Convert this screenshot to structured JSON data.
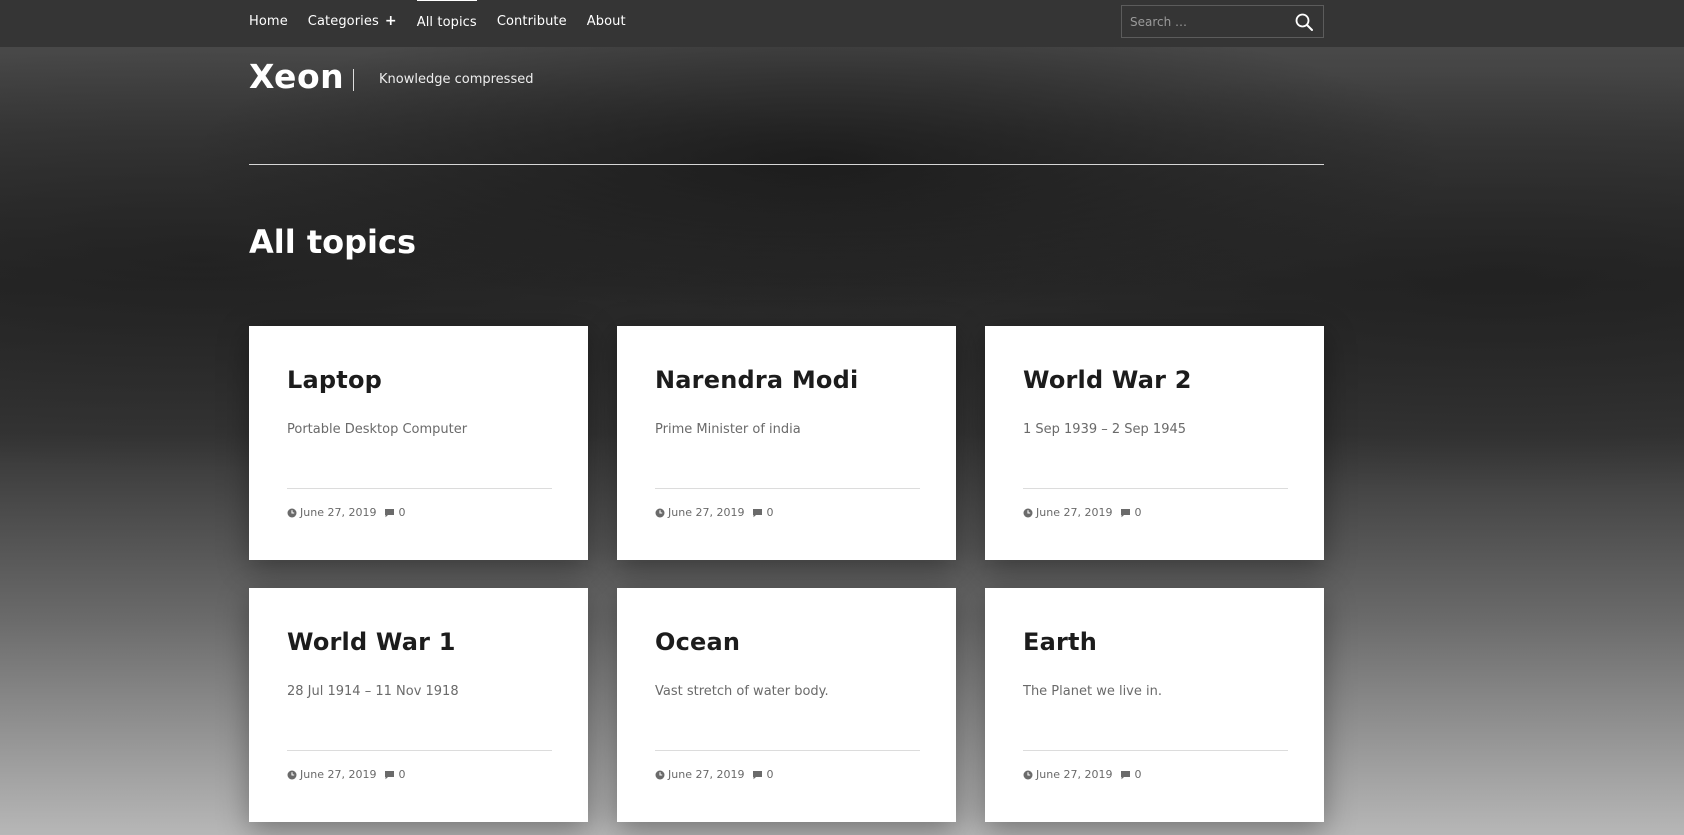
{
  "nav": {
    "items": [
      {
        "label": "Home"
      },
      {
        "label": "Categories"
      },
      {
        "label": "All topics"
      },
      {
        "label": "Contribute"
      },
      {
        "label": "About"
      }
    ],
    "active": "All topics"
  },
  "search": {
    "placeholder": "Search …",
    "icon": "search-icon"
  },
  "site": {
    "title": "Xeon",
    "tagline": "Knowledge compressed"
  },
  "page": {
    "title": "All topics"
  },
  "posts": [
    {
      "title": "Laptop",
      "excerpt": "Portable Desktop Computer",
      "date": "June 27, 2019",
      "comments": "0"
    },
    {
      "title": "Narendra Modi",
      "excerpt": "Prime Minister of india",
      "date": "June 27, 2019",
      "comments": "0"
    },
    {
      "title": "World War 2",
      "excerpt": "1 Sep 1939 – 2 Sep 1945",
      "date": "June 27, 2019",
      "comments": "0"
    },
    {
      "title": "World War 1",
      "excerpt": "28 Jul 1914 – 11 Nov 1918",
      "date": "June 27, 2019",
      "comments": "0"
    },
    {
      "title": "Ocean",
      "excerpt": "Vast stretch of water body.",
      "date": "June 27, 2019",
      "comments": "0"
    },
    {
      "title": "Earth",
      "excerpt": "The Planet we live in.",
      "date": "June 27, 2019",
      "comments": "0"
    }
  ],
  "icons": {
    "date": "clock-icon",
    "comments": "comment-icon",
    "expand": "plus-icon"
  }
}
